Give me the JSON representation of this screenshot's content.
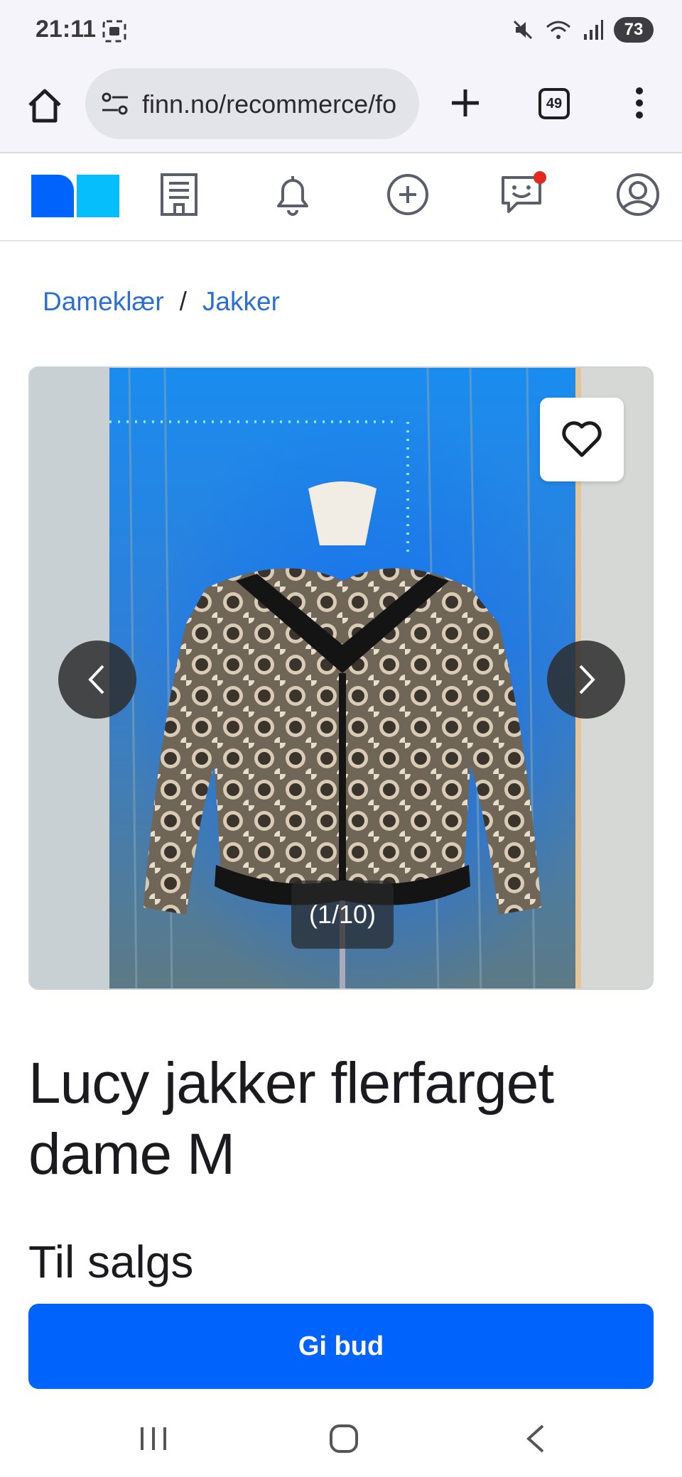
{
  "status_bar": {
    "time": "21:11",
    "battery": "73",
    "icons": [
      "screenshot-icon",
      "mute-icon",
      "wifi-icon",
      "signal-icon",
      "battery-icon"
    ]
  },
  "browser": {
    "url": "finn.no/recommerce/fo",
    "tab_count": "49",
    "icons": [
      "home-icon",
      "site-settings-icon",
      "new-tab-icon",
      "tabs-icon",
      "more-menu-icon"
    ]
  },
  "app_nav": {
    "items": [
      "finn-logo",
      "jobs-icon",
      "notifications-icon",
      "new-ad-icon",
      "messages-icon",
      "profile-icon"
    ],
    "brand_colors": {
      "primary": "#0063fb",
      "secondary": "#06befb"
    },
    "notification_dot_color": "#e5281f"
  },
  "breadcrumb": {
    "items": [
      "Dameklær",
      "Jakker"
    ],
    "separator": "/"
  },
  "gallery": {
    "counter": "(1/10)",
    "icons": [
      "heart-icon",
      "chevron-left-icon",
      "chevron-right-icon"
    ]
  },
  "listing": {
    "title": "Lucy jakker flerfarget dame M",
    "status": "Til salgs"
  },
  "cta": {
    "label": "Gi bud",
    "color": "#0063fb"
  },
  "system_nav": {
    "icons": [
      "recents-icon",
      "home-gesture-icon",
      "back-icon"
    ]
  }
}
